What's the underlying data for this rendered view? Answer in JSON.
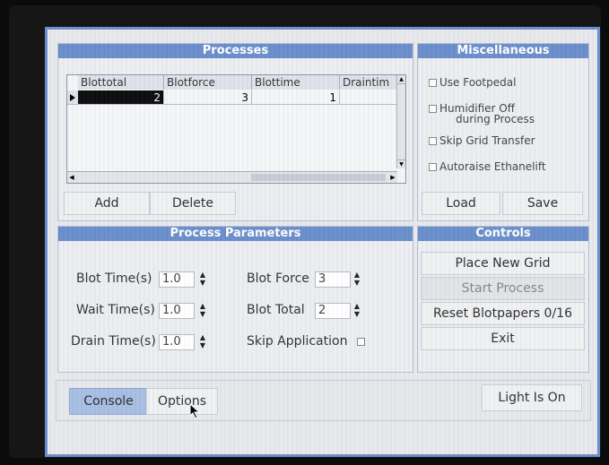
{
  "processes": {
    "title": "Processes",
    "columns": [
      "Blottotal",
      "Blotforce",
      "Blottime",
      "Draintim"
    ],
    "rows": [
      [
        "2",
        "3",
        "1",
        ""
      ]
    ],
    "add_label": "Add",
    "delete_label": "Delete"
  },
  "misc": {
    "title": "Miscellaneous",
    "use_footpedal": "Use Footpedal",
    "humidifier_line1": "Humidifier Off",
    "humidifier_line2": "during Process",
    "skip_grid": "Skip Grid Transfer",
    "autoraise": "Autoraise Ethanelift",
    "load_label": "Load",
    "save_label": "Save"
  },
  "params": {
    "title": "Process Parameters",
    "blot_time_label": "Blot Time(s)",
    "blot_time_value": "1.0",
    "wait_time_label": "Wait Time(s)",
    "wait_time_value": "1.0",
    "drain_time_label": "Drain Time(s)",
    "drain_time_value": "1.0",
    "blot_force_label": "Blot Force",
    "blot_force_value": "3",
    "blot_total_label": "Blot Total",
    "blot_total_value": "2",
    "skip_application_label": "Skip Application"
  },
  "controls": {
    "title": "Controls",
    "place_new_grid": "Place New Grid",
    "start_process": "Start Process",
    "reset_blotpapers": "Reset Blotpapers 0/16",
    "exit": "Exit"
  },
  "bottom": {
    "console_tab": "Console",
    "options_tab": "Options",
    "light_status": "Light Is On"
  }
}
